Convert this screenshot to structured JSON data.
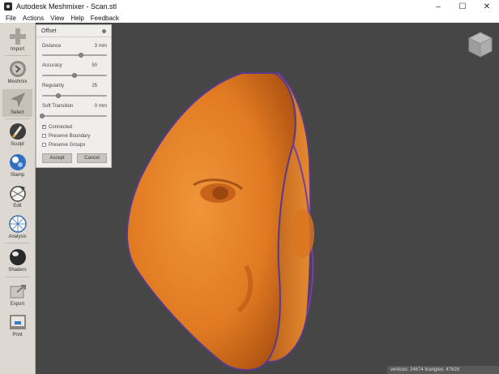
{
  "window": {
    "title": "Autodesk Meshmixer - Scan.stl",
    "minimize": "–",
    "maximize": "☐",
    "close": "✕"
  },
  "menu": [
    "File",
    "Actions",
    "View",
    "Help",
    "Feedback"
  ],
  "tools": [
    {
      "label": "Import",
      "icon": "plus-icon",
      "active": false
    },
    {
      "label": "Meshmix",
      "icon": "meshmix-icon",
      "active": false
    },
    {
      "label": "Select",
      "icon": "select-arrow-icon",
      "active": true
    },
    {
      "label": "Sculpt",
      "icon": "sculpt-brush-icon",
      "active": false
    },
    {
      "label": "Stamp",
      "icon": "stamp-icon",
      "active": false
    },
    {
      "label": "Edit",
      "icon": "edit-icon",
      "active": false
    },
    {
      "label": "Analysis",
      "icon": "analysis-icon",
      "active": false
    },
    {
      "label": "Shaders",
      "icon": "shaders-icon",
      "active": false
    },
    {
      "label": "Export",
      "icon": "export-icon",
      "active": false
    },
    {
      "label": "Print",
      "icon": "print-icon",
      "active": false
    }
  ],
  "panel": {
    "title": "Offset",
    "distance": {
      "label": "Distance",
      "value": "3",
      "unit": "mm",
      "fraction": 0.6
    },
    "accuracy": {
      "label": "Accuracy",
      "value": "50",
      "fraction": 0.5
    },
    "regularity": {
      "label": "Regularity",
      "value": "25",
      "fraction": 0.25
    },
    "soft_transition": {
      "label": "Soft Transition",
      "value": "0",
      "unit": "mm",
      "fraction": 0.0
    },
    "connected": {
      "label": "Connected",
      "checked": true
    },
    "preserve_boundary": {
      "label": "Preserve Boundary",
      "checked": false
    },
    "preserve_groups": {
      "label": "Preserve Groups",
      "checked": false
    },
    "accept_label": "Accept",
    "cancel_label": "Cancel"
  },
  "status": "vertices: 24674  triangles: 47626",
  "colors": {
    "viewport": "#464646",
    "mesh": "#e07a22",
    "mesh_edge": "#5a3a8a",
    "sidebar": "#ddd8d1"
  }
}
